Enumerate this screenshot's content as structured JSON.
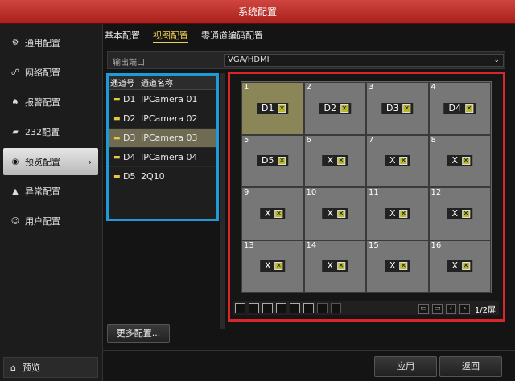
{
  "window": {
    "title": "系统配置"
  },
  "sidebar": {
    "items": [
      {
        "label": "通用配置",
        "icon": "gear-icon",
        "glyph": "⚙"
      },
      {
        "label": "网络配置",
        "icon": "network-icon",
        "glyph": "☍"
      },
      {
        "label": "报警配置",
        "icon": "alarm-icon",
        "glyph": "♠"
      },
      {
        "label": "232配置",
        "icon": "serial-port-icon",
        "glyph": "▰"
      },
      {
        "label": "预览配置",
        "icon": "eye-icon",
        "glyph": "◉",
        "active": true
      },
      {
        "label": "异常配置",
        "icon": "warning-icon",
        "glyph": "▲"
      },
      {
        "label": "用户配置",
        "icon": "users-icon",
        "glyph": "☺"
      }
    ],
    "home": {
      "label": "预览",
      "icon": "home-icon",
      "glyph": "⌂"
    }
  },
  "tabs": [
    {
      "label": "基本配置",
      "active": false
    },
    {
      "label": "视图配置",
      "active": true
    },
    {
      "label": "零通道编码配置",
      "active": false
    }
  ],
  "output": {
    "label": "输出端口",
    "value": "VGA/HDMI"
  },
  "channels": {
    "headers": {
      "no": "通道号",
      "name": "通道名称"
    },
    "rows": [
      {
        "no": "D1",
        "name": "IPCamera 01"
      },
      {
        "no": "D2",
        "name": "IPCamera 02"
      },
      {
        "no": "D3",
        "name": "IPCamera 03",
        "selected": true
      },
      {
        "no": "D4",
        "name": "IPCamera 04"
      },
      {
        "no": "D5",
        "name": "2Q10"
      }
    ]
  },
  "grid": {
    "cells": [
      {
        "idx": "1",
        "label": "D1"
      },
      {
        "idx": "2",
        "label": "D2"
      },
      {
        "idx": "3",
        "label": "D3"
      },
      {
        "idx": "4",
        "label": "D4"
      },
      {
        "idx": "5",
        "label": "D5"
      },
      {
        "idx": "6",
        "label": "X"
      },
      {
        "idx": "7",
        "label": "X"
      },
      {
        "idx": "8",
        "label": "X"
      },
      {
        "idx": "9",
        "label": "X"
      },
      {
        "idx": "10",
        "label": "X"
      },
      {
        "idx": "11",
        "label": "X"
      },
      {
        "idx": "12",
        "label": "X"
      },
      {
        "idx": "13",
        "label": "X"
      },
      {
        "idx": "14",
        "label": "X"
      },
      {
        "idx": "15",
        "label": "X"
      },
      {
        "idx": "16",
        "label": "X"
      }
    ],
    "page": "1/2屏"
  },
  "buttons": {
    "more": "更多配置...",
    "apply": "应用",
    "back": "返回"
  }
}
